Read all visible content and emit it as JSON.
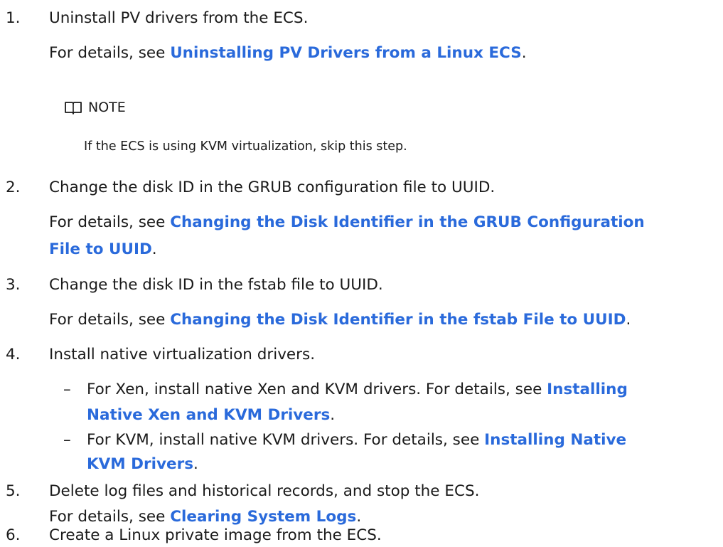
{
  "steps": [
    {
      "num": "1.",
      "title": "Uninstall PV drivers from the ECS.",
      "detail_prefix": "For details, see ",
      "link": "Uninstalling PV Drivers from a Linux ECS",
      "detail_suffix": "."
    },
    {
      "num": "2.",
      "title": "Change the disk ID in the GRUB configuration file to UUID.",
      "detail_prefix": "For details, see ",
      "link_line1": "Changing the Disk Identifier in the GRUB Configuration",
      "link_line2": "File to UUID",
      "detail_suffix": "."
    },
    {
      "num": "3.",
      "title": "Change the disk ID in the fstab file to UUID.",
      "detail_prefix": "For details, see ",
      "link": "Changing the Disk Identifier in the fstab File to UUID",
      "detail_suffix": "."
    },
    {
      "num": "4.",
      "title": "Install native virtualization drivers.",
      "sub": [
        {
          "dash": "–",
          "text": "For Xen, install native Xen and KVM drivers. For details, see ",
          "link_line1": "Installing",
          "link_line2": "Native Xen and KVM Drivers",
          "suffix": "."
        },
        {
          "dash": "–",
          "text": "For KVM, install native KVM drivers. For details, see ",
          "link_line1": "Installing Native",
          "link_line2": "KVM Drivers",
          "suffix": "."
        }
      ]
    },
    {
      "num": "5.",
      "title": "Delete log files and historical records, and stop the ECS.",
      "detail_prefix": "For details, see ",
      "link": "Clearing System Logs",
      "detail_suffix": "."
    },
    {
      "num": "6.",
      "title": "Create a Linux private image from the ECS."
    }
  ],
  "note": {
    "icon": "book-icon",
    "label": "NOTE",
    "text": "If the ECS is using KVM virtualization, skip this step."
  },
  "colors": {
    "link": "#2a6adb",
    "text": "#1a1a1a"
  }
}
